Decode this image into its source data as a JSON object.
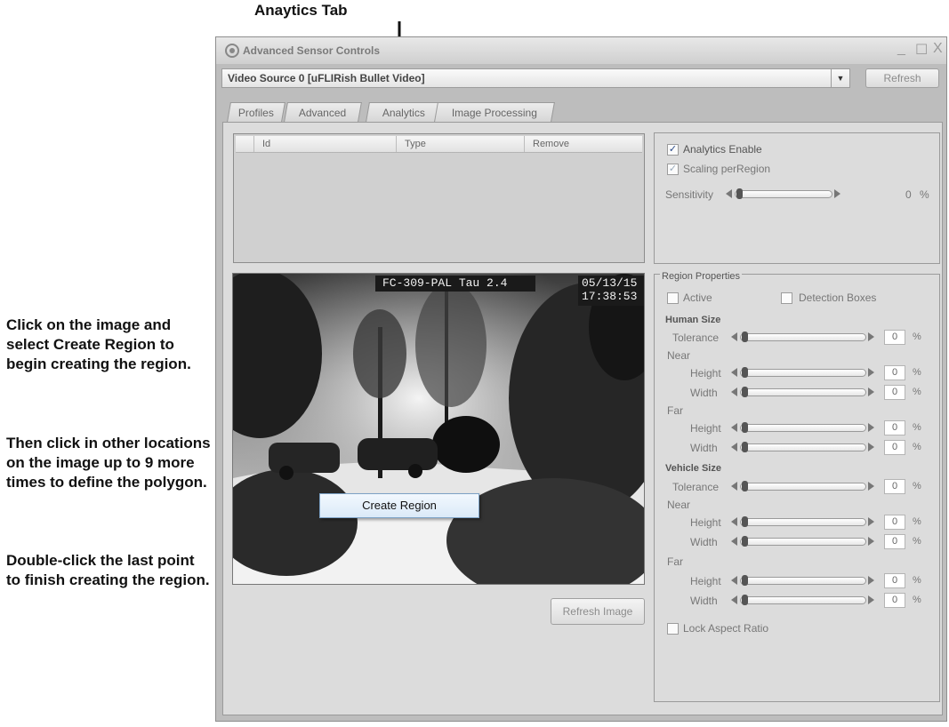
{
  "callouts": {
    "analytics_tab": "Anaytics Tab",
    "instructions": [
      "Click on the image and select Create Region to begin creating the region.",
      "Then click in other locations on the image up to 9 more times to define the polygon.",
      "Double-click the last point to finish creating the region."
    ]
  },
  "window": {
    "title": "Advanced Sensor Controls",
    "minimize": "_",
    "maximize": "☐",
    "close": "X"
  },
  "source": {
    "selected": "Video Source 0 [uFLIRish Bullet Video]",
    "caret": "▼",
    "refresh_label": "Refresh"
  },
  "tabs": [
    "Profiles",
    "Advanced",
    "Analytics",
    "Image Processing"
  ],
  "region_table": {
    "columns": [
      "Id",
      "Type",
      "Remove"
    ]
  },
  "video": {
    "overlay_left": "FC-309-PAL Tau 2.4",
    "overlay_date": "05/13/15",
    "overlay_time": "17:38:53",
    "context_menu_item": "Create Region",
    "refresh_image_label": "Refresh Image"
  },
  "analytics": {
    "enable_label": "Analytics Enable",
    "enable_checked": true,
    "scaling_label": "Scaling perRegion",
    "scaling_checked": true,
    "sensitivity_label": "Sensitivity",
    "sensitivity_value": "0",
    "unit": "%"
  },
  "region_properties": {
    "title": "Region Properties",
    "active_label": "Active",
    "detection_boxes_label": "Detection Boxes",
    "human_size_label": "Human Size",
    "vehicle_size_label": "Vehicle Size",
    "tolerance_label": "Tolerance",
    "near_label": "Near",
    "far_label": "Far",
    "height_label": "Height",
    "width_label": "Width",
    "value": "0",
    "unit": "%",
    "lock_aspect_label": "Lock Aspect Ratio"
  },
  "colors": {
    "window_bg": "#bdbdbd",
    "panel_bg": "#dcdcdc",
    "menu_bg": "#dbeaf8",
    "check_accent": "#2a4a8a"
  }
}
